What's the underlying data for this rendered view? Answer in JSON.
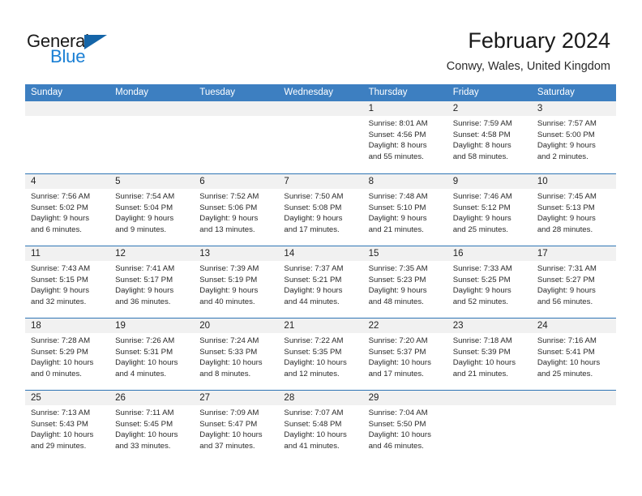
{
  "brand": {
    "name_top": "General",
    "name_bottom": "Blue",
    "triangle_color": "#1565a8",
    "blue_text_color": "#1a7fd4"
  },
  "header": {
    "title": "February 2024",
    "location": "Conwy, Wales, United Kingdom"
  },
  "theme": {
    "header_blue": "#3d7fc1",
    "row_divider_blue": "#2f75b5",
    "day_strip_gray": "#f1f1f1"
  },
  "calendar": {
    "weekday_headers": [
      "Sunday",
      "Monday",
      "Tuesday",
      "Wednesday",
      "Thursday",
      "Friday",
      "Saturday"
    ],
    "weeks": [
      [
        {
          "day": "",
          "sunrise": "",
          "sunset": "",
          "daylight_line1": "",
          "daylight_line2": ""
        },
        {
          "day": "",
          "sunrise": "",
          "sunset": "",
          "daylight_line1": "",
          "daylight_line2": ""
        },
        {
          "day": "",
          "sunrise": "",
          "sunset": "",
          "daylight_line1": "",
          "daylight_line2": ""
        },
        {
          "day": "",
          "sunrise": "",
          "sunset": "",
          "daylight_line1": "",
          "daylight_line2": ""
        },
        {
          "day": "1",
          "sunrise": "Sunrise: 8:01 AM",
          "sunset": "Sunset: 4:56 PM",
          "daylight_line1": "Daylight: 8 hours",
          "daylight_line2": "and 55 minutes."
        },
        {
          "day": "2",
          "sunrise": "Sunrise: 7:59 AM",
          "sunset": "Sunset: 4:58 PM",
          "daylight_line1": "Daylight: 8 hours",
          "daylight_line2": "and 58 minutes."
        },
        {
          "day": "3",
          "sunrise": "Sunrise: 7:57 AM",
          "sunset": "Sunset: 5:00 PM",
          "daylight_line1": "Daylight: 9 hours",
          "daylight_line2": "and 2 minutes."
        }
      ],
      [
        {
          "day": "4",
          "sunrise": "Sunrise: 7:56 AM",
          "sunset": "Sunset: 5:02 PM",
          "daylight_line1": "Daylight: 9 hours",
          "daylight_line2": "and 6 minutes."
        },
        {
          "day": "5",
          "sunrise": "Sunrise: 7:54 AM",
          "sunset": "Sunset: 5:04 PM",
          "daylight_line1": "Daylight: 9 hours",
          "daylight_line2": "and 9 minutes."
        },
        {
          "day": "6",
          "sunrise": "Sunrise: 7:52 AM",
          "sunset": "Sunset: 5:06 PM",
          "daylight_line1": "Daylight: 9 hours",
          "daylight_line2": "and 13 minutes."
        },
        {
          "day": "7",
          "sunrise": "Sunrise: 7:50 AM",
          "sunset": "Sunset: 5:08 PM",
          "daylight_line1": "Daylight: 9 hours",
          "daylight_line2": "and 17 minutes."
        },
        {
          "day": "8",
          "sunrise": "Sunrise: 7:48 AM",
          "sunset": "Sunset: 5:10 PM",
          "daylight_line1": "Daylight: 9 hours",
          "daylight_line2": "and 21 minutes."
        },
        {
          "day": "9",
          "sunrise": "Sunrise: 7:46 AM",
          "sunset": "Sunset: 5:12 PM",
          "daylight_line1": "Daylight: 9 hours",
          "daylight_line2": "and 25 minutes."
        },
        {
          "day": "10",
          "sunrise": "Sunrise: 7:45 AM",
          "sunset": "Sunset: 5:13 PM",
          "daylight_line1": "Daylight: 9 hours",
          "daylight_line2": "and 28 minutes."
        }
      ],
      [
        {
          "day": "11",
          "sunrise": "Sunrise: 7:43 AM",
          "sunset": "Sunset: 5:15 PM",
          "daylight_line1": "Daylight: 9 hours",
          "daylight_line2": "and 32 minutes."
        },
        {
          "day": "12",
          "sunrise": "Sunrise: 7:41 AM",
          "sunset": "Sunset: 5:17 PM",
          "daylight_line1": "Daylight: 9 hours",
          "daylight_line2": "and 36 minutes."
        },
        {
          "day": "13",
          "sunrise": "Sunrise: 7:39 AM",
          "sunset": "Sunset: 5:19 PM",
          "daylight_line1": "Daylight: 9 hours",
          "daylight_line2": "and 40 minutes."
        },
        {
          "day": "14",
          "sunrise": "Sunrise: 7:37 AM",
          "sunset": "Sunset: 5:21 PM",
          "daylight_line1": "Daylight: 9 hours",
          "daylight_line2": "and 44 minutes."
        },
        {
          "day": "15",
          "sunrise": "Sunrise: 7:35 AM",
          "sunset": "Sunset: 5:23 PM",
          "daylight_line1": "Daylight: 9 hours",
          "daylight_line2": "and 48 minutes."
        },
        {
          "day": "16",
          "sunrise": "Sunrise: 7:33 AM",
          "sunset": "Sunset: 5:25 PM",
          "daylight_line1": "Daylight: 9 hours",
          "daylight_line2": "and 52 minutes."
        },
        {
          "day": "17",
          "sunrise": "Sunrise: 7:31 AM",
          "sunset": "Sunset: 5:27 PM",
          "daylight_line1": "Daylight: 9 hours",
          "daylight_line2": "and 56 minutes."
        }
      ],
      [
        {
          "day": "18",
          "sunrise": "Sunrise: 7:28 AM",
          "sunset": "Sunset: 5:29 PM",
          "daylight_line1": "Daylight: 10 hours",
          "daylight_line2": "and 0 minutes."
        },
        {
          "day": "19",
          "sunrise": "Sunrise: 7:26 AM",
          "sunset": "Sunset: 5:31 PM",
          "daylight_line1": "Daylight: 10 hours",
          "daylight_line2": "and 4 minutes."
        },
        {
          "day": "20",
          "sunrise": "Sunrise: 7:24 AM",
          "sunset": "Sunset: 5:33 PM",
          "daylight_line1": "Daylight: 10 hours",
          "daylight_line2": "and 8 minutes."
        },
        {
          "day": "21",
          "sunrise": "Sunrise: 7:22 AM",
          "sunset": "Sunset: 5:35 PM",
          "daylight_line1": "Daylight: 10 hours",
          "daylight_line2": "and 12 minutes."
        },
        {
          "day": "22",
          "sunrise": "Sunrise: 7:20 AM",
          "sunset": "Sunset: 5:37 PM",
          "daylight_line1": "Daylight: 10 hours",
          "daylight_line2": "and 17 minutes."
        },
        {
          "day": "23",
          "sunrise": "Sunrise: 7:18 AM",
          "sunset": "Sunset: 5:39 PM",
          "daylight_line1": "Daylight: 10 hours",
          "daylight_line2": "and 21 minutes."
        },
        {
          "day": "24",
          "sunrise": "Sunrise: 7:16 AM",
          "sunset": "Sunset: 5:41 PM",
          "daylight_line1": "Daylight: 10 hours",
          "daylight_line2": "and 25 minutes."
        }
      ],
      [
        {
          "day": "25",
          "sunrise": "Sunrise: 7:13 AM",
          "sunset": "Sunset: 5:43 PM",
          "daylight_line1": "Daylight: 10 hours",
          "daylight_line2": "and 29 minutes."
        },
        {
          "day": "26",
          "sunrise": "Sunrise: 7:11 AM",
          "sunset": "Sunset: 5:45 PM",
          "daylight_line1": "Daylight: 10 hours",
          "daylight_line2": "and 33 minutes."
        },
        {
          "day": "27",
          "sunrise": "Sunrise: 7:09 AM",
          "sunset": "Sunset: 5:47 PM",
          "daylight_line1": "Daylight: 10 hours",
          "daylight_line2": "and 37 minutes."
        },
        {
          "day": "28",
          "sunrise": "Sunrise: 7:07 AM",
          "sunset": "Sunset: 5:48 PM",
          "daylight_line1": "Daylight: 10 hours",
          "daylight_line2": "and 41 minutes."
        },
        {
          "day": "29",
          "sunrise": "Sunrise: 7:04 AM",
          "sunset": "Sunset: 5:50 PM",
          "daylight_line1": "Daylight: 10 hours",
          "daylight_line2": "and 46 minutes."
        },
        {
          "day": "",
          "sunrise": "",
          "sunset": "",
          "daylight_line1": "",
          "daylight_line2": ""
        },
        {
          "day": "",
          "sunrise": "",
          "sunset": "",
          "daylight_line1": "",
          "daylight_line2": ""
        }
      ]
    ]
  }
}
